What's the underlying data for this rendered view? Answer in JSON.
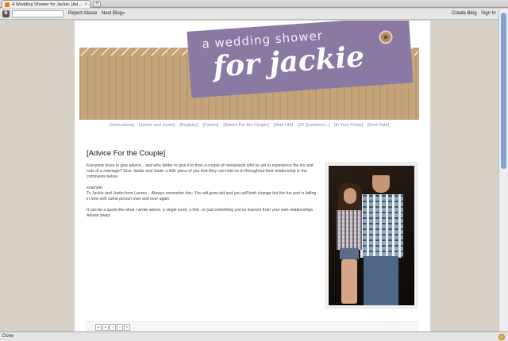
{
  "browser": {
    "tab_title": "A Wedding Shower for Jackie: [Ad...",
    "tab_close": "×",
    "new_tab": "+",
    "status": "Done"
  },
  "navbar": {
    "logo": "B",
    "report_abuse": "Report Abuse",
    "next_blog": "Next Blog»",
    "create_blog": "Create Blog",
    "sign_in": "Sign In"
  },
  "header": {
    "line1": "a wedding shower",
    "line2": "for jackie"
  },
  "nav": {
    "items": [
      "[Instructions]",
      "[Jackie and Justin]",
      "[Registry]",
      "[Favors]",
      "[Advice For the Couple]",
      "[Mad Lib!]",
      "[20 Questions...]",
      "[In Your Purse]",
      "[First Date]"
    ],
    "active_index": 4
  },
  "post": {
    "title": "[Advice For the Couple]",
    "p1": "Everyone loves to give advice... and who better to give it to than a couple of newlyweds who've yet to experience the ins and outs of a marriage? Give Jackie and Justin a little piece of you that they can hold on to throughout their relationship in the comments below.",
    "example_label": "example:",
    "example_intro": "To Jackie and Justin from Lauren... Always remember this: ",
    "example_quote": "You will grow old and you will both change but the fun part is falling in love with same person over and over again.",
    "p3": "It can be a quote like what I wrote above, a single word, a link...or just something you've learned from your own relationships. Advise away!"
  },
  "share": {
    "buttons": [
      "M",
      "B",
      "t",
      "f",
      "P"
    ]
  },
  "colors": {
    "tag": "#8a7aa3",
    "bag": "#c6a47a",
    "active_nav": "#8b76b6"
  }
}
